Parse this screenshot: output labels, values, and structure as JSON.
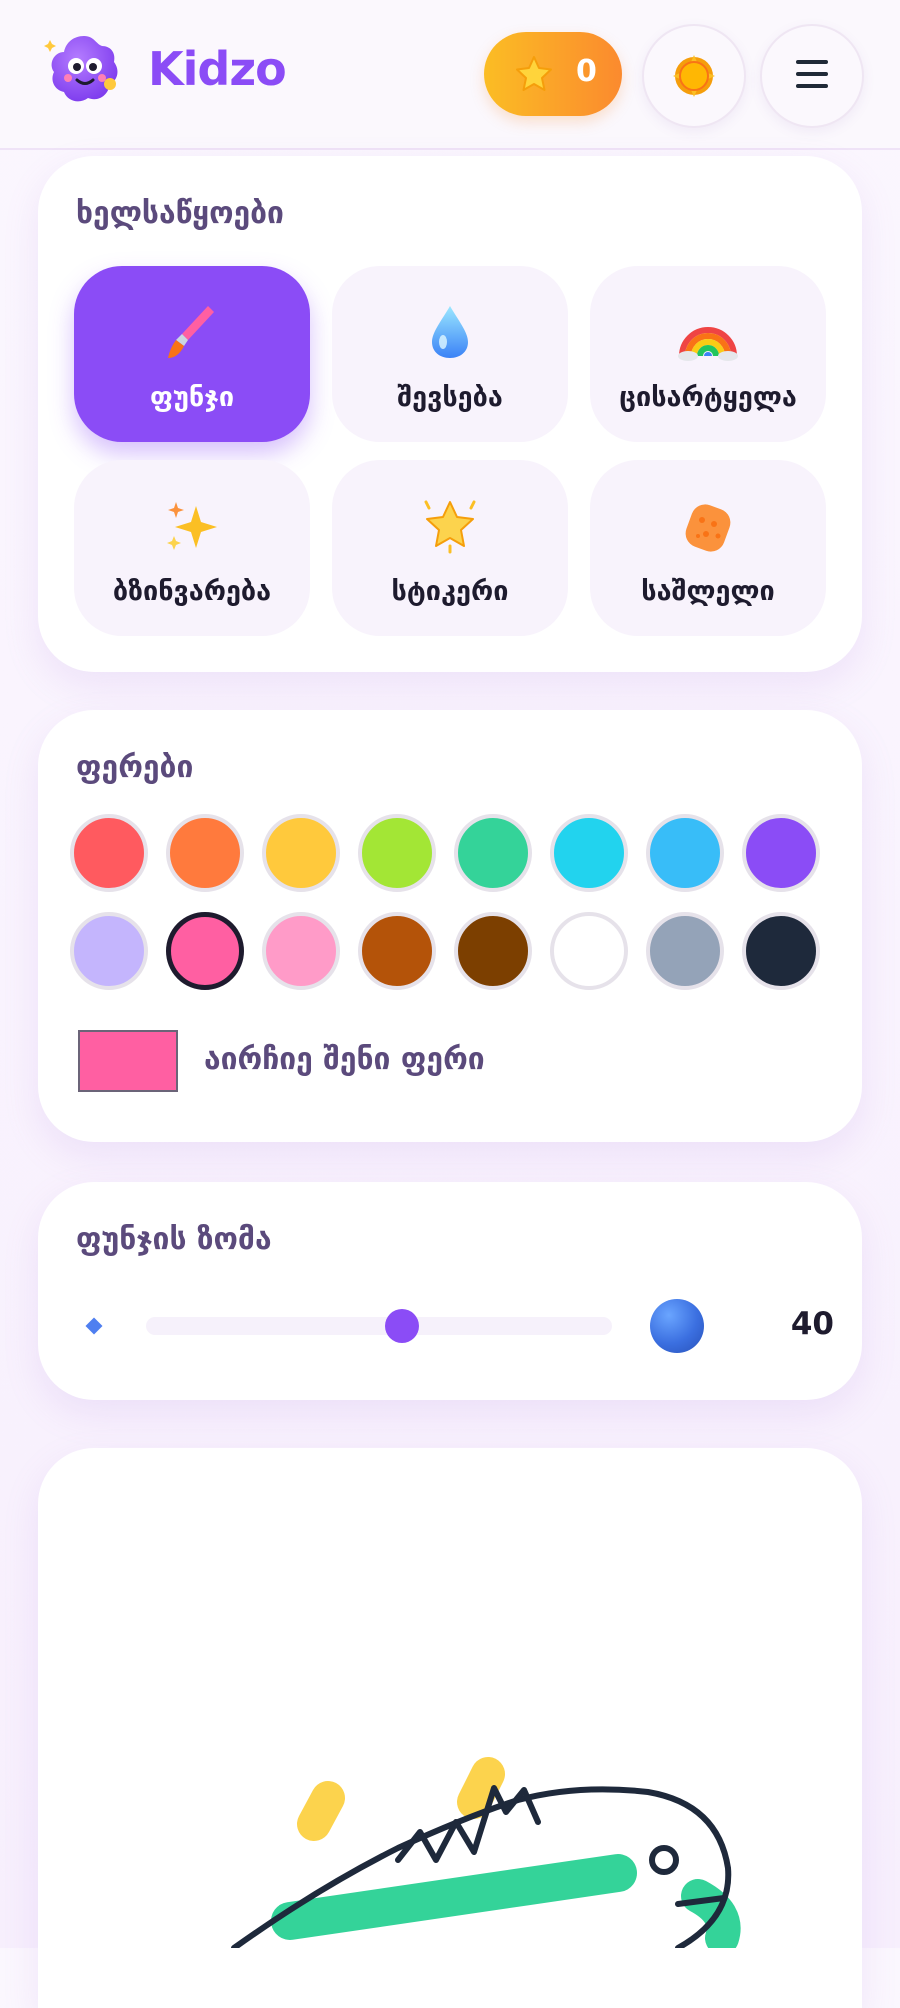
{
  "header": {
    "brand": "Kidzo",
    "stars_count": "0",
    "logo_icon": "purple-monster-logo-icon",
    "star_icon": "star-icon",
    "theme_icon": "sun-icon",
    "menu_icon": "hamburger-menu-icon"
  },
  "tools": {
    "title": "ხელსაწყოები",
    "items": [
      {
        "label": "ფუნჯი",
        "icon": "paintbrush-icon",
        "active": true
      },
      {
        "label": "შევსება",
        "icon": "droplet-icon",
        "active": false
      },
      {
        "label": "ცისარტყელა",
        "icon": "rainbow-icon",
        "active": false
      },
      {
        "label": "ბზინვარება",
        "icon": "sparkles-icon",
        "active": false
      },
      {
        "label": "სტიკერი",
        "icon": "glowing-star-icon",
        "active": false
      },
      {
        "label": "საშლელი",
        "icon": "sponge-icon",
        "active": false
      }
    ]
  },
  "colors": {
    "title": "ფერები",
    "palette": [
      "#ff5a5f",
      "#ff7a3d",
      "#ffc93c",
      "#a3e635",
      "#34d399",
      "#22d3ee",
      "#38bdf8",
      "#8b4cf6",
      "#c4b5fd",
      "#ff5fa2",
      "#ff9bc8",
      "#b45309",
      "#7c3f00",
      "#ffffff",
      "#94a3b8",
      "#1e293b"
    ],
    "selected_index": 9,
    "custom_color": "#ff5fa2",
    "custom_label": "აირჩიე შენი ფერი"
  },
  "brush_size": {
    "title": "ფუნჯის ზომა",
    "value": 40,
    "slider_fraction": 0.55,
    "value_text": "40"
  },
  "canvas": {
    "label": "drawing-canvas"
  }
}
